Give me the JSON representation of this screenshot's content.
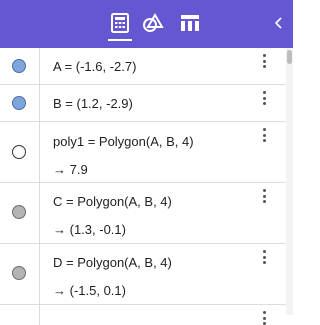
{
  "toolbar": {
    "background": "#6557d2",
    "icons": [
      "calculator-icon",
      "shapes-icon",
      "table-icon"
    ],
    "active": "calculator-icon",
    "collapse_icon": "chevron-left-icon"
  },
  "algebra": {
    "rows": [
      {
        "definition": "A = (-1.6, -2.7)",
        "output": "",
        "marker": "filled-blue"
      },
      {
        "definition": "B = (1.2, -2.9)",
        "output": "",
        "marker": "filled-blue"
      },
      {
        "definition": "poly1 = Polygon(A, B, 4)",
        "output": "→ 7.9",
        "marker": "empty"
      },
      {
        "definition": "C = Polygon(A, B, 4)",
        "output": "→ (1.3, -0.1)",
        "marker": "filled-gray"
      },
      {
        "definition": "D = Polygon(A, B, 4)",
        "output": "→ (-1.5, 0.1)",
        "marker": "filled-gray"
      }
    ]
  },
  "colors": {
    "point_blue": "#7ea6dd",
    "point_gray": "#b3b3b3",
    "divider": "#dcdcdc"
  }
}
